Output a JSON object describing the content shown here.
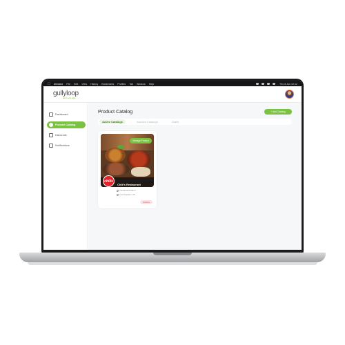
{
  "menubar": {
    "items": [
      "Chrome",
      "File",
      "Edit",
      "View",
      "History",
      "Bookmarks",
      "Profiles",
      "Tab",
      "Window",
      "Help"
    ],
    "clock": "Thu 8 Jun 10:12"
  },
  "header": {
    "logo_text": "gullyloop",
    "logo_tagline": "all-in-one app"
  },
  "sidebar": {
    "items": [
      {
        "label": "Dashboard",
        "icon": "grid-icon",
        "active": false
      },
      {
        "label": "Product Catalog",
        "icon": "catalog-icon",
        "active": true
      },
      {
        "label": "Discounts",
        "icon": "percent-icon",
        "active": false
      },
      {
        "label": "Notifications",
        "icon": "bell-icon",
        "active": false
      }
    ]
  },
  "main": {
    "title": "Product Catalog",
    "add_button": "+ Add Catalog",
    "tabs": [
      {
        "label": "Active Catalogs",
        "active": true
      },
      {
        "label": "Inactive Catalogs",
        "active": false
      },
      {
        "label": "Drafts",
        "active": false
      }
    ]
  },
  "catalog_card": {
    "badge": "Manage Product",
    "brand_logo_text": "chilis",
    "restaurant_name": "Chili's Restaurant",
    "meta_line1": "Restaurant Menu",
    "meta_line2": "Los Angeles, US",
    "status": "Inactive"
  },
  "colors": {
    "accent": "#7cc242",
    "brand_red": "#e2232a",
    "status_red": "#e04a4a"
  },
  "dock": {
    "icons": [
      "finder-icon",
      "launchpad-icon",
      "safari-icon",
      "messages-icon",
      "mail-icon",
      "maps-icon",
      "photos-icon",
      "facetime-icon",
      "calendar-icon",
      "contacts-icon",
      "reminders-icon",
      "notes-icon",
      "music-icon",
      "podcasts-icon",
      "tv-icon",
      "news-icon",
      "appstore-icon",
      "settings-icon",
      "chrome-icon",
      "vscode-icon",
      "slack-icon",
      "figma-icon",
      "terminal-icon",
      "folder-icon",
      "trash-icon"
    ],
    "icon_colors": [
      "#3a8ee6",
      "#8a8a8a",
      "#2f9bf0",
      "#42c35a",
      "#3a86f0",
      "#5ac16a",
      "#f0a030",
      "#3dbb5a",
      "#ffffff",
      "#b08a5a",
      "#f5f5f5",
      "#f5d54a",
      "#f2485c",
      "#9a4ad0",
      "#222222",
      "#f04444",
      "#2d8cf0",
      "#8a8a8a",
      "#e9e9e9",
      "#2a7ad0",
      "#5a2a6a",
      "#f05a3a",
      "#1a1a1a",
      "#5aa0e0",
      "#bcbcbc"
    ]
  }
}
